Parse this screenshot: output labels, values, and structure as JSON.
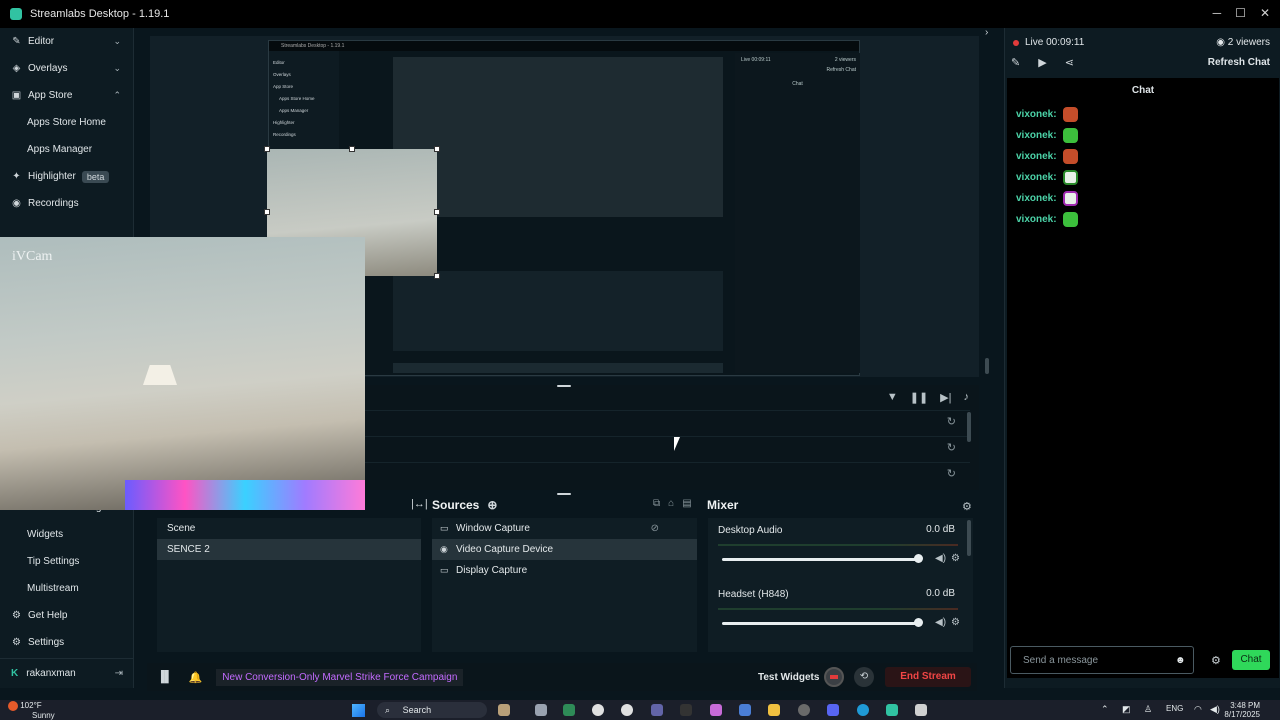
{
  "app": {
    "title": "Streamlabs Desktop - 1.19.1"
  },
  "sidebar": {
    "items": [
      {
        "label": "Editor",
        "icon": "edit-icon"
      },
      {
        "label": "Overlays",
        "icon": "layers-icon"
      },
      {
        "label": "App Store",
        "icon": "store-icon"
      },
      {
        "label": "Apps Store Home"
      },
      {
        "label": "Apps Manager"
      },
      {
        "label": "Highlighter",
        "badge": "beta",
        "icon": "highlighter-icon"
      },
      {
        "label": "Recordings",
        "icon": "recordings-icon"
      }
    ],
    "lower": [
      {
        "label": "Alert Box Settings"
      },
      {
        "label": "Widgets"
      },
      {
        "label": "Tip Settings"
      },
      {
        "label": "Multistream"
      },
      {
        "label": "Get Help",
        "icon": "help-icon"
      },
      {
        "label": "Settings",
        "icon": "gear-icon"
      }
    ],
    "user": "rakanxman"
  },
  "preview": {
    "webcam_label": "iVCam"
  },
  "scenes": {
    "items": [
      "Scene",
      "SENCE 2"
    ],
    "selected": "SENCE 2"
  },
  "sources": {
    "title": "Sources",
    "items": [
      "Window Capture",
      "Video Capture Device",
      "Display Capture"
    ]
  },
  "mixer": {
    "title": "Mixer",
    "items": [
      {
        "name": "Desktop Audio",
        "db": "0.0 dB",
        "level": 0.99
      },
      {
        "name": "Headset (H848)",
        "db": "0.0 dB",
        "level": 0.99
      }
    ]
  },
  "footer": {
    "promo": "New Conversion-Only Marvel Strike Force Campaign",
    "test_widgets": "Test Widgets",
    "end_stream": "End Stream"
  },
  "chat": {
    "live": "Live 00:09:11",
    "viewers": "2 viewers",
    "refresh": "Refresh Chat",
    "title": "Chat",
    "messages": [
      "vixonek:",
      "vixonek:",
      "vixonek:",
      "vixonek:",
      "vixonek:",
      "vixonek:"
    ],
    "input_placeholder": "Send a message",
    "send": "Chat"
  },
  "taskbar": {
    "temp": "102°F",
    "weather": "Sunny",
    "search": "Search",
    "lang": "ENG",
    "time": "3:48 PM",
    "date": "8/17/2025"
  },
  "inner": {
    "title": "Streamlabs Desktop - 1.19.1",
    "live": "Live 00:09:11",
    "viewers": "2 viewers",
    "refresh": "Refresh Chat",
    "chat": "Chat",
    "sidebar": [
      "Editor",
      "Overlays",
      "App Store",
      "Apps Store Home",
      "Apps Manager",
      "Highlighter",
      "Recordings"
    ]
  }
}
